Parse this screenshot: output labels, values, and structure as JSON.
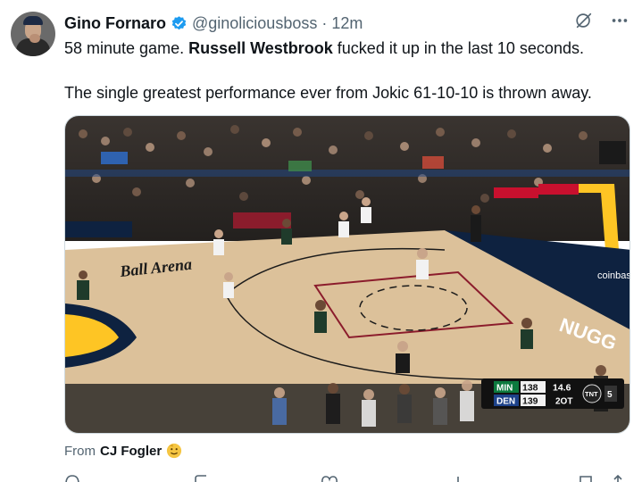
{
  "tweet": {
    "author_name": "Gino Fornaro",
    "handle": "@ginoliciousboss",
    "separator": "·",
    "time": "12m",
    "text_p1_a": "58 minute game. ",
    "text_p1_b": "Russell Westbrook",
    "text_p1_c": " fucked it up in the last 10 seconds.",
    "text_p2": "The single greatest performance ever from Jokic 61-10-10 is thrown away.",
    "verified_color": "#1d9bf0"
  },
  "media": {
    "arena_logo": "Ball Arena",
    "court_sign": "NUGG",
    "coinbase": "coinbase",
    "score_bug": {
      "team1": "MIN",
      "score1": "138",
      "team2": "DEN",
      "score2": "139",
      "clock": "14.6",
      "period": "2OT",
      "network": "TNT",
      "shot_clock": "5"
    },
    "colors": {
      "court": "#dcc19a",
      "den_gold": "#fec524",
      "den_navy": "#0e2240"
    }
  },
  "attribution": {
    "prefix": "From",
    "source": "CJ Fogler"
  },
  "icons": {
    "more": "more-icon",
    "grok": "grok-icon"
  }
}
